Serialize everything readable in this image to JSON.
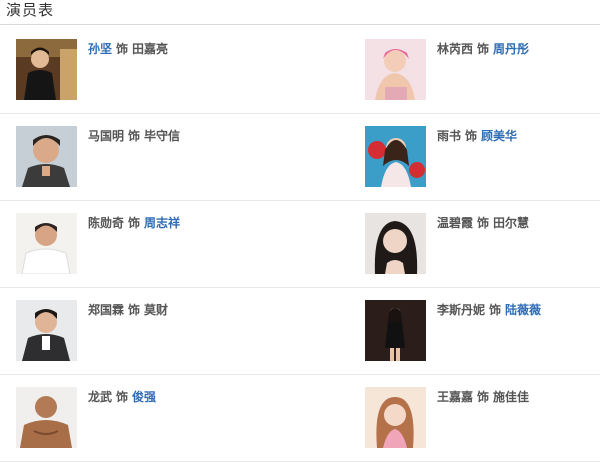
{
  "section": {
    "title": "演员表"
  },
  "as_word": "饰",
  "cast": [
    {
      "actor": "孙坚",
      "actor_linked": true,
      "role": "田嘉亮",
      "role_linked": false,
      "photo": "actor-photo-sunjian"
    },
    {
      "actor": "林芮西",
      "actor_linked": false,
      "role": "周丹彤",
      "role_linked": true,
      "photo": "actor-photo-linruixi"
    },
    {
      "actor": "马国明",
      "actor_linked": false,
      "role": "毕守信",
      "role_linked": false,
      "photo": "actor-photo-maguoming"
    },
    {
      "actor": "雨书",
      "actor_linked": false,
      "role": "顾美华",
      "role_linked": true,
      "photo": "actor-photo-yushu"
    },
    {
      "actor": "陈勋奇",
      "actor_linked": false,
      "role": "周志祥",
      "role_linked": true,
      "photo": "actor-photo-chenxunqi"
    },
    {
      "actor": "温碧霞",
      "actor_linked": false,
      "role": "田尔慧",
      "role_linked": false,
      "photo": "actor-photo-wenbixia"
    },
    {
      "actor": "郑国霖",
      "actor_linked": false,
      "role": "莫财",
      "role_linked": false,
      "photo": "actor-photo-zhengguolin"
    },
    {
      "actor": "李斯丹妮",
      "actor_linked": false,
      "role": "陆薇薇",
      "role_linked": true,
      "photo": "actor-photo-lisidanni"
    },
    {
      "actor": "龙武",
      "actor_linked": false,
      "role": "俊强",
      "role_linked": true,
      "photo": "actor-photo-longwu"
    },
    {
      "actor": "王嘉嘉",
      "actor_linked": false,
      "role": "施佳佳",
      "role_linked": false,
      "photo": "actor-photo-wangjiajia"
    }
  ],
  "colors": {
    "link": "#2f6db5",
    "text": "#555555",
    "divider": "#e9e9e9"
  }
}
